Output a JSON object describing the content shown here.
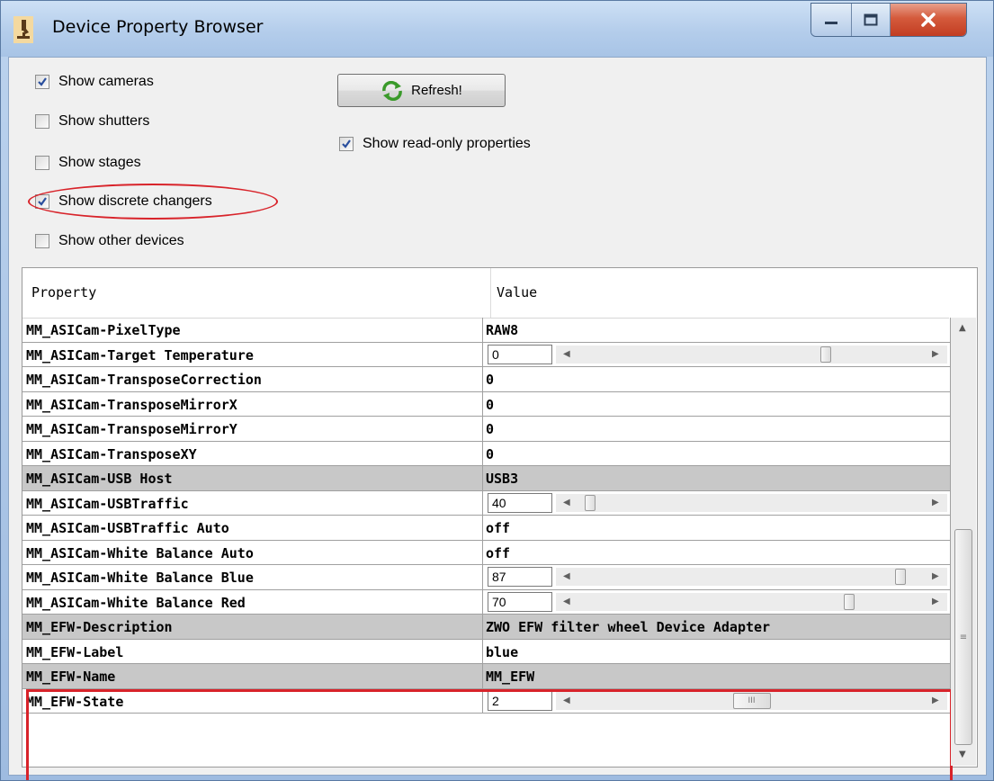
{
  "window": {
    "title": "Device Property Browser",
    "app_icon": "microscope-icon"
  },
  "filters": {
    "show_cameras": {
      "label": "Show cameras",
      "checked": true
    },
    "show_shutters": {
      "label": "Show shutters",
      "checked": false
    },
    "show_stages": {
      "label": "Show stages",
      "checked": false
    },
    "show_discrete_changers": {
      "label": "Show discrete changers",
      "checked": true
    },
    "show_other_devices": {
      "label": "Show other devices",
      "checked": false
    },
    "show_readonly": {
      "label": "Show read-only properties",
      "checked": true
    }
  },
  "refresh_label": "Refresh!",
  "table": {
    "col_property": "Property",
    "col_value": "Value",
    "rows": [
      {
        "property": "MM_ASICam-PixelType",
        "value": "RAW8",
        "readonly": false,
        "slider": false
      },
      {
        "property": "MM_ASICam-Target Temperature",
        "value": "0",
        "readonly": false,
        "slider": true,
        "slider_pos": 0.72
      },
      {
        "property": "MM_ASICam-TransposeCorrection",
        "value": "0",
        "readonly": false,
        "slider": false
      },
      {
        "property": "MM_ASICam-TransposeMirrorX",
        "value": "0",
        "readonly": false,
        "slider": false
      },
      {
        "property": "MM_ASICam-TransposeMirrorY",
        "value": "0",
        "readonly": false,
        "slider": false
      },
      {
        "property": "MM_ASICam-TransposeXY",
        "value": "0",
        "readonly": false,
        "slider": false
      },
      {
        "property": "MM_ASICam-USB Host",
        "value": "USB3",
        "readonly": true,
        "slider": false
      },
      {
        "property": "MM_ASICam-USBTraffic",
        "value": "40",
        "readonly": false,
        "slider": true,
        "slider_pos": 0.02
      },
      {
        "property": "MM_ASICam-USBTraffic Auto",
        "value": "off",
        "readonly": false,
        "slider": false
      },
      {
        "property": "MM_ASICam-White Balance Auto",
        "value": "off",
        "readonly": false,
        "slider": false
      },
      {
        "property": "MM_ASICam-White Balance Blue",
        "value": "87",
        "readonly": false,
        "slider": true,
        "slider_pos": 0.94
      },
      {
        "property": "MM_ASICam-White Balance Red",
        "value": "70",
        "readonly": false,
        "slider": true,
        "slider_pos": 0.79
      },
      {
        "property": "MM_EFW-Description",
        "value": "ZWO EFW filter wheel Device Adapter",
        "readonly": true,
        "slider": false
      },
      {
        "property": "MM_EFW-Label",
        "value": "blue",
        "readonly": false,
        "slider": false
      },
      {
        "property": "MM_EFW-Name",
        "value": "MM_EFW",
        "readonly": true,
        "slider": false
      },
      {
        "property": "MM_EFW-State",
        "value": "2",
        "readonly": false,
        "slider": true,
        "slider_pos": 0.5,
        "wide_thumb": true
      }
    ]
  },
  "colors": {
    "highlight": "#d8232a",
    "readonly_row": "#c8c8c8"
  }
}
